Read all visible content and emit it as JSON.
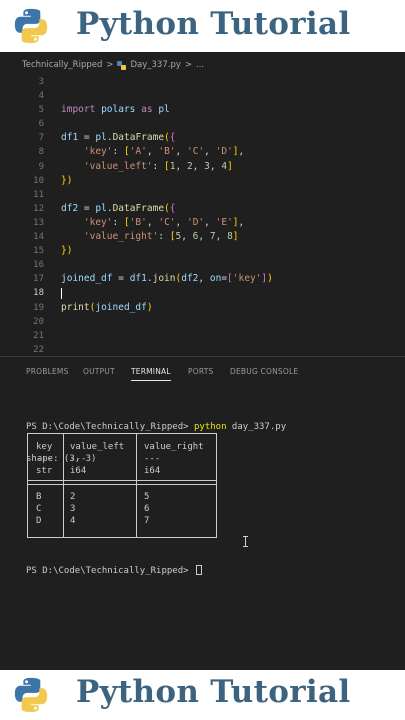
{
  "banner": {
    "title": "Python Tutorial"
  },
  "breadcrumb": {
    "folder": "Technically_Ripped",
    "separator": ">",
    "file": "Day_337.py",
    "more": "..."
  },
  "code_lines": [
    {
      "n": "3",
      "t": ""
    },
    {
      "n": "4",
      "t": ""
    },
    {
      "n": "5",
      "t": "import polars as pl"
    },
    {
      "n": "6",
      "t": ""
    },
    {
      "n": "7",
      "t": "df1 = pl.DataFrame({"
    },
    {
      "n": "8",
      "t": "    'key': ['A', 'B', 'C', 'D'],"
    },
    {
      "n": "9",
      "t": "    'value_left': [1, 2, 3, 4]"
    },
    {
      "n": "10",
      "t": "})"
    },
    {
      "n": "11",
      "t": ""
    },
    {
      "n": "12",
      "t": "df2 = pl.DataFrame({"
    },
    {
      "n": "13",
      "t": "    'key': ['B', 'C', 'D', 'E'],"
    },
    {
      "n": "14",
      "t": "    'value_right': [5, 6, 7, 8]"
    },
    {
      "n": "15",
      "t": "})"
    },
    {
      "n": "16",
      "t": ""
    },
    {
      "n": "17",
      "t": "joined_df = df1.join(df2, on=['key'])"
    },
    {
      "n": "18",
      "t": ""
    },
    {
      "n": "19",
      "t": "print(joined_df)"
    },
    {
      "n": "20",
      "t": ""
    },
    {
      "n": "21",
      "t": ""
    },
    {
      "n": "22",
      "t": ""
    }
  ],
  "panel_tabs": [
    "PROBLEMS",
    "OUTPUT",
    "TERMINAL",
    "PORTS",
    "DEBUG CONSOLE"
  ],
  "active_tab": "TERMINAL",
  "terminal": {
    "prompt": "PS D:\\Code\\Technically_Ripped>",
    "command_name": "python",
    "command_arg": "day_337.py",
    "shape_line": "shape: (3, 3)",
    "table": {
      "headers": [
        "key",
        "value_left",
        "value_right"
      ],
      "dashes": [
        "---",
        "---",
        "---"
      ],
      "dtypes": [
        "str",
        "i64",
        "i64"
      ],
      "rows": [
        [
          "B",
          "2",
          "5"
        ],
        [
          "C",
          "3",
          "6"
        ],
        [
          "D",
          "4",
          "7"
        ]
      ]
    },
    "final_prompt": "PS D:\\Code\\Technically_Ripped>"
  },
  "colors": {
    "banner_text": "#3c6481",
    "editor_bg": "#1f1f1f",
    "keyword": "#c586c0",
    "function": "#dcdcaa",
    "variable": "#9cdcfe",
    "string": "#ce9178",
    "number": "#b5cea8"
  },
  "icons": {
    "banner_logo": "python-logo",
    "file_icon": "python-file-icon",
    "mouse_pointer": "text-cursor-ibeam"
  }
}
